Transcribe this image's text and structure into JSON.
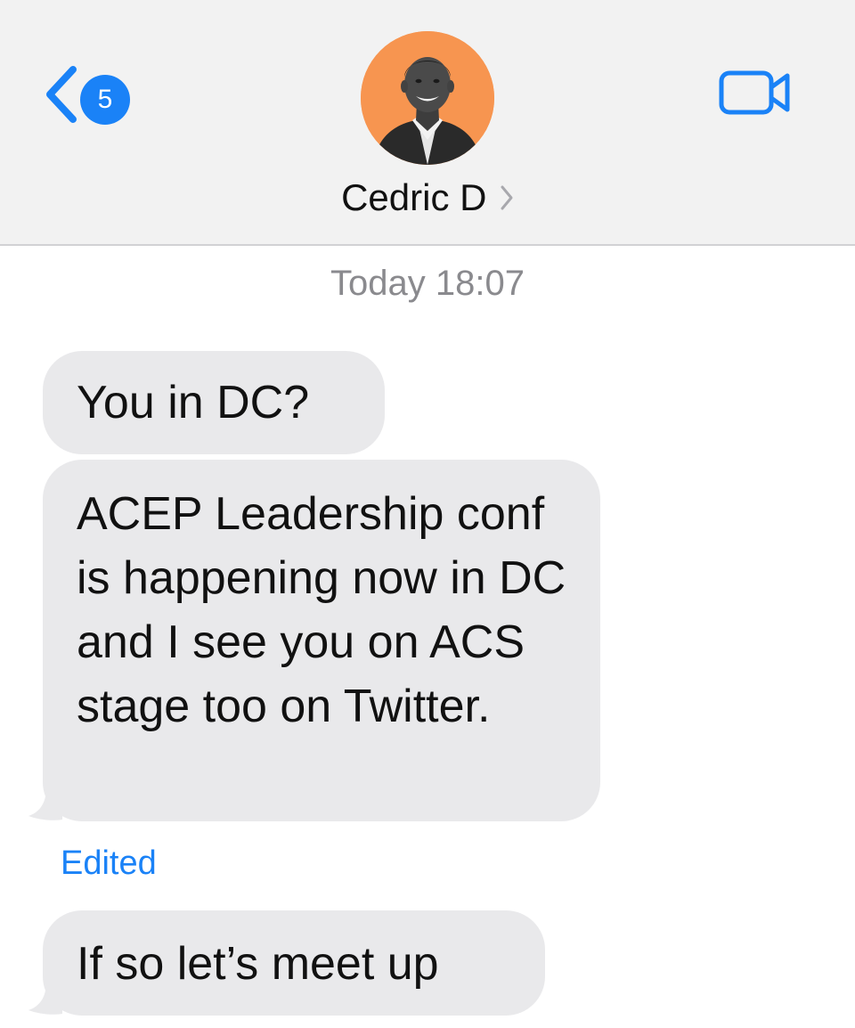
{
  "header": {
    "back_badge_count": "5",
    "contact_name": "Cedric D",
    "icons": {
      "back": "chevron-left-icon",
      "details": "chevron-right-icon",
      "video": "video-camera-icon"
    },
    "colors": {
      "accent": "#1a82f7",
      "avatar_background": "#f79550",
      "header_background": "#f2f2f2"
    }
  },
  "conversation": {
    "timestamp": "Today 18:07",
    "messages": [
      {
        "text": "You in DC?",
        "direction": "incoming"
      },
      {
        "text": "ACEP Leadership conf is happening now in DC and I see you on ACS stage too on Twitter.",
        "direction": "incoming",
        "edited_label": "Edited"
      },
      {
        "text": "If so let’s meet up",
        "direction": "incoming"
      }
    ],
    "colors": {
      "incoming_bubble": "#e9e9eb",
      "timestamp_text": "#8a8a8e"
    }
  }
}
